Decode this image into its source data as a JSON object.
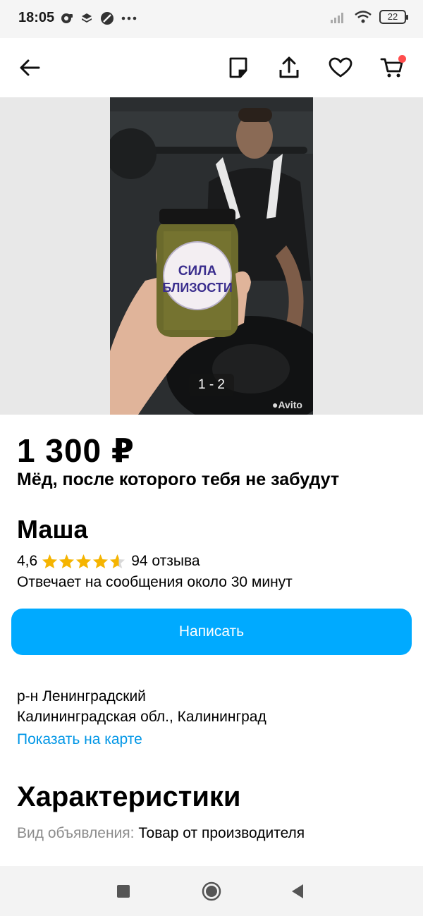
{
  "status_bar": {
    "time": "18:05",
    "battery": "22"
  },
  "header": {
    "icons": [
      "back-arrow-icon",
      "note-icon",
      "share-icon",
      "heart-icon",
      "cart-icon"
    ],
    "cart_badge_color": "#ff4d4d"
  },
  "gallery": {
    "counter": "1 - 2",
    "watermark": "Avito",
    "jar_label": "СИЛА БЛИЗОСТИ"
  },
  "listing": {
    "price": "1 300 ₽",
    "title": "Мёд, после которого тебя не забудут"
  },
  "seller": {
    "name": "Маша",
    "rating": "4,6",
    "rating_value": 4.6,
    "reviews": "94 отзыва",
    "response_time": "Отвечает на сообщения около 30 минут"
  },
  "actions": {
    "write_label": "Написать",
    "accent": "#00aaff"
  },
  "location": {
    "district": "р-н Ленинградский",
    "region_city": "Калининградская обл., Калининград",
    "map_link": "Показать на карте"
  },
  "specs": {
    "title": "Характеристики",
    "items": [
      {
        "label": "Вид объявления:",
        "value": "Товар от производителя"
      }
    ]
  },
  "nav": {
    "icons": [
      "recent-apps-icon",
      "home-icon",
      "back-icon"
    ]
  }
}
